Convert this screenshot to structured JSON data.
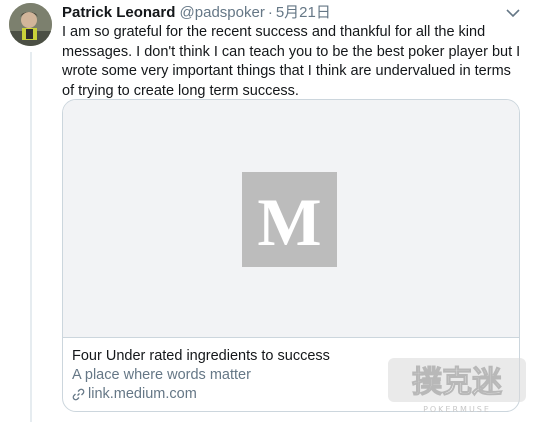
{
  "tweet": {
    "author_name": "Patrick Leonard",
    "handle": "@padspoker",
    "separator": "·",
    "date": "5月21日",
    "text": "I am so grateful for the recent success and thankful for all the kind messages. I don't think I can teach you to be the best poker player but I wrote some very important things that I think are undervalued in terms of trying to create long term success."
  },
  "card": {
    "logo_letter": "M",
    "title": "Four Under rated ingredients to success",
    "description": "A place where words matter",
    "domain": "link.medium.com"
  },
  "watermark": {
    "text": "撲克迷",
    "subtext": "POKERMUSE"
  },
  "colors": {
    "secondary_text": "#657786",
    "border": "#ccd6dd",
    "logo_bg": "#bcbcbc"
  },
  "icons": [
    "avatar",
    "chevron-down-icon",
    "medium-logo",
    "link-icon"
  ]
}
